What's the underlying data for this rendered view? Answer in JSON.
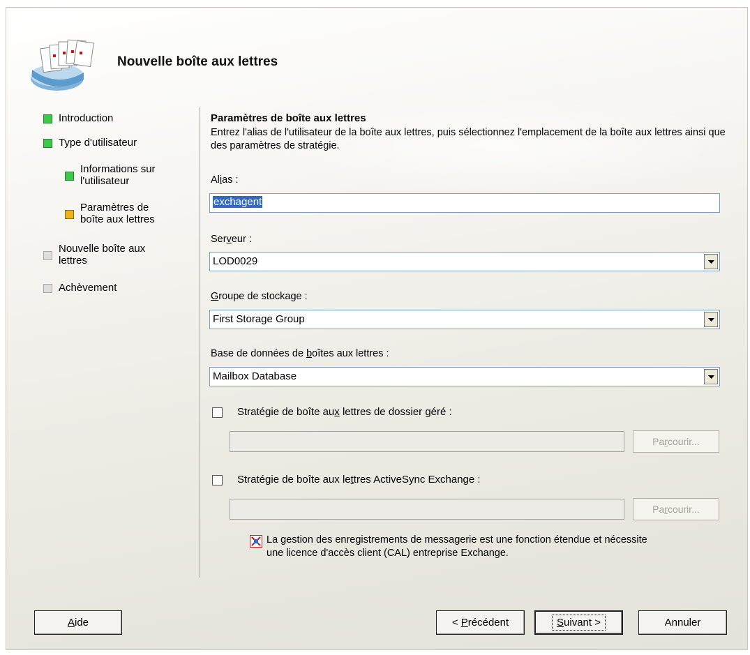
{
  "header": {
    "title": "Nouvelle boîte aux lettres",
    "icon": "mailbox-stack-icon"
  },
  "nav": {
    "items": [
      {
        "label_lines": [
          "Introduction"
        ],
        "status": "completed",
        "color": "#3cc94a"
      },
      {
        "label_lines": [
          "Type d'utilisateur"
        ],
        "status": "completed",
        "color": "#3cc94a"
      },
      {
        "label_lines": [
          "Informations sur",
          "l'utilisateur"
        ],
        "status": "completed",
        "color": "#3cc94a"
      },
      {
        "label_lines": [
          "Paramètres de",
          "boîte aux lettres"
        ],
        "status": "current",
        "color": "#f0b21c"
      },
      {
        "label_lines": [
          "Nouvelle boîte aux",
          "lettres"
        ],
        "status": "pending",
        "color": "#dedede"
      },
      {
        "label_lines": [
          "Achèvement"
        ],
        "status": "pending",
        "color": "#dedede"
      }
    ]
  },
  "panel": {
    "title": "Paramètres de boîte aux lettres",
    "description": "Entrez l'alias de l'utilisateur de la boîte aux lettres, puis sélectionnez l'emplacement de la boîte aux lettres ainsi que des paramètres de stratégie.",
    "alias": {
      "label_pre": "Al",
      "label_u": "i",
      "label_post": "as :",
      "value": "exchagent"
    },
    "server": {
      "label_pre": "Ser",
      "label_u": "v",
      "label_post": "eur :",
      "value": "LOD0029"
    },
    "storage_group": {
      "label_pre": "",
      "label_u": "G",
      "label_post": "roupe de stockage :",
      "value": "First Storage Group"
    },
    "database": {
      "label_pre": "Base de données de ",
      "label_u": "b",
      "label_post": "oîtes aux lettres :",
      "value": "Mailbox Database"
    },
    "managed_folder": {
      "label_pre": "Stratégie de boîte au",
      "label_u": "x",
      "label_post": " lettres de dossier géré :",
      "checked": false,
      "value": ""
    },
    "activesync": {
      "label_pre": "Stratégie de boîte aux le",
      "label_u": "t",
      "label_post": "tres ActiveSync Exchange :",
      "checked": false,
      "value": ""
    },
    "browse_pre": "Pa",
    "browse_u": "r",
    "browse_post": "courir...",
    "info": "La gestion des enregistrements de messagerie est une fonction étendue et nécessite une licence d'accès client (CAL) entreprise Exchange."
  },
  "footer": {
    "help_u": "A",
    "help_post": "ide",
    "prev_pre": "< ",
    "prev_u": "P",
    "prev_post": "récédent",
    "next_u": "S",
    "next_post": "uivant >",
    "cancel": "Annuler"
  }
}
